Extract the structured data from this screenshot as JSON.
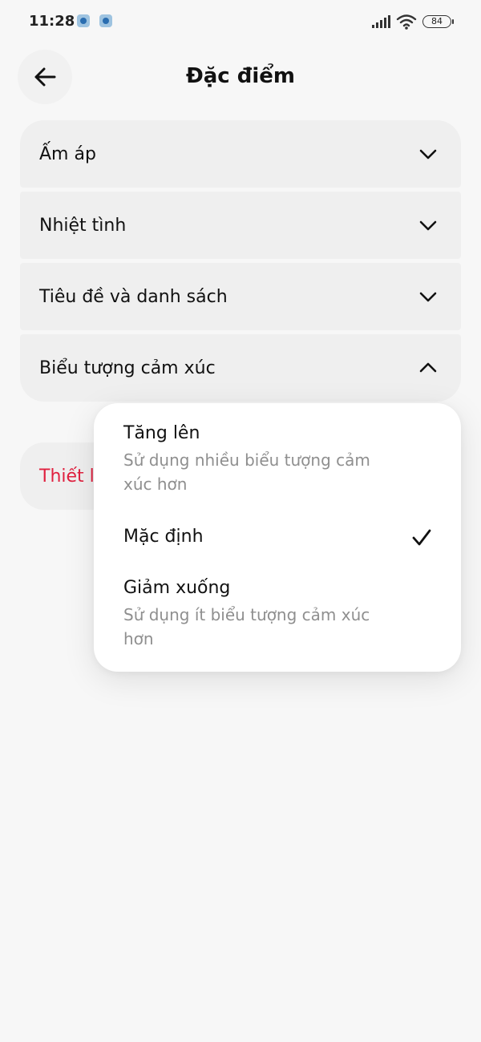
{
  "status_bar": {
    "time": "11:28",
    "battery": "84",
    "icons": [
      "notification-app-icon",
      "notification-app-icon",
      "signal-icon",
      "wifi-icon",
      "battery-icon"
    ]
  },
  "header": {
    "title": "Đặc điểm",
    "back_icon": "arrow-left-icon"
  },
  "sections": [
    {
      "label": "Ấm áp",
      "expanded": false
    },
    {
      "label": "Nhiệt tình",
      "expanded": false
    },
    {
      "label": "Tiêu đề và danh sách",
      "expanded": false
    },
    {
      "label": "Biểu tượng cảm xúc",
      "expanded": true
    }
  ],
  "reset": {
    "label": "Thiết lập lại",
    "visible_label": "Thiết l",
    "color": "#e0203f"
  },
  "popup": {
    "options": [
      {
        "title": "Tăng lên",
        "description": "Sử dụng nhiều biểu tượng cảm xúc hơn",
        "selected": false
      },
      {
        "title": "Mặc định",
        "description": "",
        "selected": true
      },
      {
        "title": "Giảm xuống",
        "description": "Sử dụng ít biểu tượng cảm xúc hơn",
        "selected": false
      }
    ],
    "check_icon": "checkmark-icon"
  }
}
